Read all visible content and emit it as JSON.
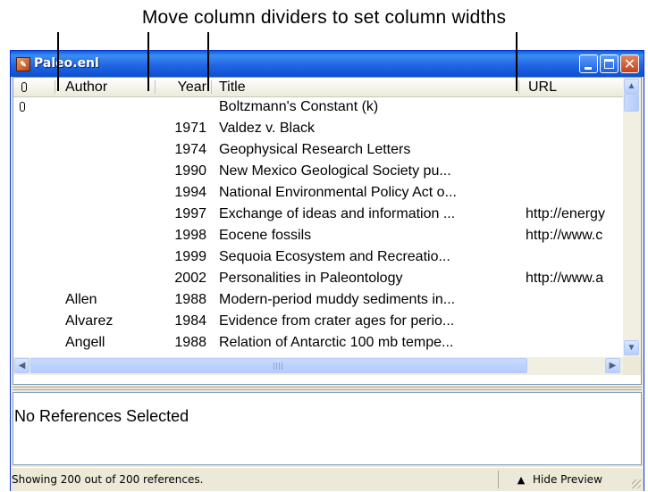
{
  "annotation": {
    "caption": "Move column dividers to set column widths"
  },
  "window": {
    "title": "Paleo.enl",
    "icon": "endnote-library-icon"
  },
  "columns": {
    "attachment_icon": "paperclip-icon",
    "author": "Author",
    "year": "Year",
    "title": "Title",
    "url": "URL"
  },
  "rows": [
    {
      "attachment": true,
      "author": "",
      "year": "",
      "title": "Boltzmann's Constant (k)",
      "url": ""
    },
    {
      "attachment": false,
      "author": "",
      "year": "1971",
      "title": "Valdez v. Black",
      "url": ""
    },
    {
      "attachment": false,
      "author": "",
      "year": "1974",
      "title": "Geophysical Research Letters",
      "url": ""
    },
    {
      "attachment": false,
      "author": "",
      "year": "1990",
      "title": "New Mexico Geological Society pu...",
      "url": ""
    },
    {
      "attachment": false,
      "author": "",
      "year": "1994",
      "title": "National Environmental Policy Act o...",
      "url": ""
    },
    {
      "attachment": false,
      "author": "",
      "year": "1997",
      "title": "Exchange of ideas and information ...",
      "url": "http://energy"
    },
    {
      "attachment": false,
      "author": "",
      "year": "1998",
      "title": "Eocene fossils",
      "url": "http://www.c"
    },
    {
      "attachment": false,
      "author": "",
      "year": "1999",
      "title": "Sequoia Ecosystem and Recreatio...",
      "url": ""
    },
    {
      "attachment": false,
      "author": "",
      "year": "2002",
      "title": "Personalities in Paleontology",
      "url": "http://www.a"
    },
    {
      "attachment": false,
      "author": "Allen",
      "year": "1988",
      "title": "Modern-period muddy sediments in...",
      "url": ""
    },
    {
      "attachment": false,
      "author": "Alvarez",
      "year": "1984",
      "title": "Evidence from crater ages for perio...",
      "url": ""
    },
    {
      "attachment": false,
      "author": "Angell",
      "year": "1988",
      "title": "Relation of Antarctic 100 mb tempe...",
      "url": ""
    }
  ],
  "preview": {
    "text": "No References Selected"
  },
  "status": {
    "text": "Showing 200 out of 200 references.",
    "hide_preview_label": "Hide Preview"
  },
  "colors": {
    "titlebar": "#0a5fd8",
    "window_frame": "#ece9d8",
    "close_button": "#c4421d"
  }
}
